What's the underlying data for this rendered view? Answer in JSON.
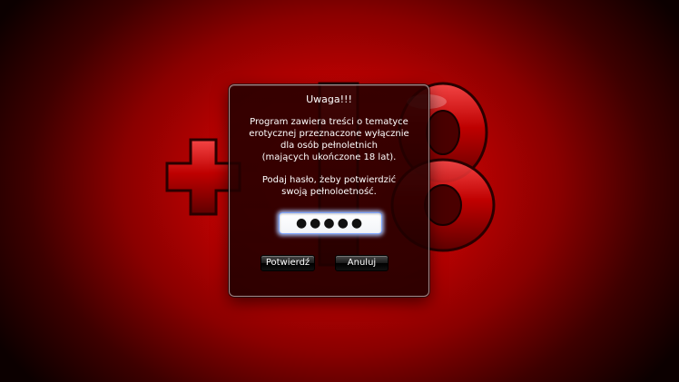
{
  "background": {
    "emblem_name": "plus-18-emblem-icon",
    "accent_color": "#d00000"
  },
  "dialog": {
    "title": "Uwaga!!!",
    "message": "Program  zawiera treści o tematyce\nerotycznej przeznaczone wyłącznie\ndla osób pełnoletnich\n(mających ukończone 18 lat).",
    "prompt": "Podaj hasło, żeby potwierdzić\nswoją pełnoloetność.",
    "password_value": "●●●●●",
    "confirm_label": "Potwierdź",
    "cancel_label": "Anuluj"
  }
}
